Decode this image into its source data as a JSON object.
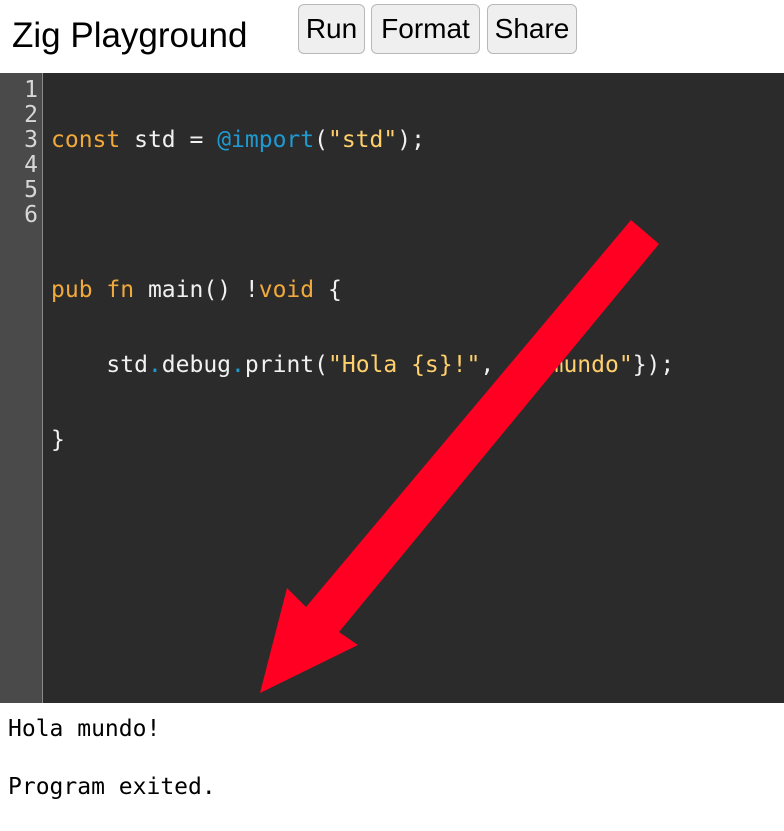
{
  "header": {
    "title": "Zig Playground",
    "buttons": {
      "run": "Run",
      "format": "Format",
      "share": "Share"
    }
  },
  "editor": {
    "line_numbers": [
      "1",
      "2",
      "3",
      "4",
      "5",
      "6"
    ],
    "tokens": {
      "l1_const": "const",
      "l1_std": " std = ",
      "l1_import": "@import",
      "l1_paren_open": "(",
      "l1_str": "\"std\"",
      "l1_end": ");",
      "l3_pub": "pub",
      "l3_sp": " ",
      "l3_fn": "fn",
      "l3_main": " main() !",
      "l3_void": "void",
      "l3_brace": " {",
      "l4_indent": "    std",
      "l4_dot1": ".",
      "l4_debug": "debug",
      "l4_dot2": ".",
      "l4_print": "print(",
      "l4_str1": "\"Hola {s}!\"",
      "l4_comma": ", ",
      "l4_dot3": ".",
      "l4_brace_open": "{",
      "l4_str2": "\"mundo\"",
      "l4_end": "});",
      "l5_brace": "}"
    },
    "colors": {
      "background": "#2b2b2b",
      "gutter": "#4a4a4a",
      "keyword": "#f2a93b",
      "builtin": "#1f9ad1",
      "string": "#ffd06b",
      "plain": "#f1f1f1"
    }
  },
  "annotation": {
    "arrow_color": "#ff0022",
    "direction": "pointing-down-left-to-output"
  },
  "output": {
    "lines": [
      "Hola mundo!",
      "",
      "Program exited."
    ]
  }
}
